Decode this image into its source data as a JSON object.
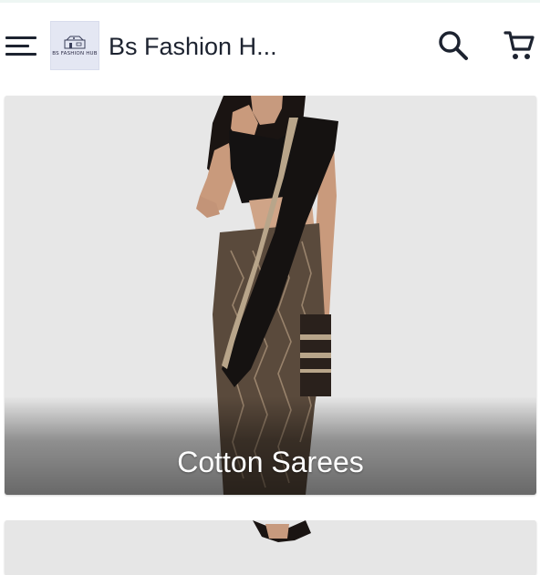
{
  "app_bar": {
    "title": "Bs Fashion H...",
    "logo_text": "BS FASHION HUB",
    "menu_icon": "hamburger-menu-icon",
    "search_icon": "search-icon",
    "cart_icon": "cart-icon"
  },
  "categories": [
    {
      "label": "Cotton Sarees"
    }
  ],
  "colors": {
    "app_bar_bg": "#ffffff",
    "icon_color": "#1d2330",
    "card_bg": "#e6e6e6",
    "label_color": "#ffffff"
  }
}
